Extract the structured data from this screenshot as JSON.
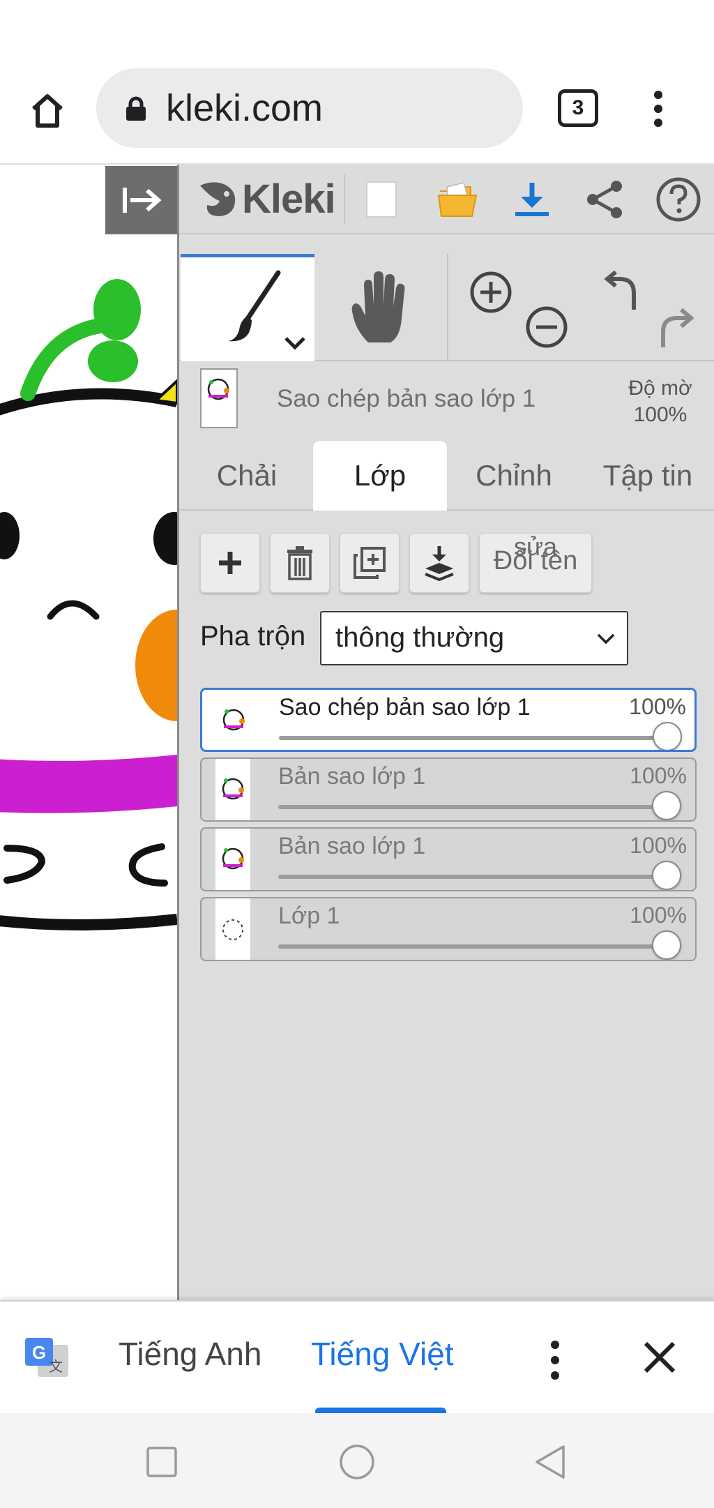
{
  "browser": {
    "url": "kleki.com",
    "tab_count": "3"
  },
  "app": {
    "logo_text": "Kleki"
  },
  "layer_info": {
    "name": "Sao chép bản sao lớp 1",
    "opacity_label": "Độ mờ",
    "opacity_value": "100%"
  },
  "tabs": [
    {
      "label": "Chải",
      "active": false
    },
    {
      "label": "Lớp",
      "active": true
    },
    {
      "label": "Chỉnh",
      "active": false
    },
    {
      "label": "Tập tin",
      "active": false
    }
  ],
  "actions": {
    "rename_top": "sửa",
    "rename_label": "Đổi tên"
  },
  "blend": {
    "label": "Pha trộn",
    "value": "thông thường"
  },
  "layers": [
    {
      "name": "Sao chép bản sao lớp 1",
      "opacity": "100%",
      "selected": true
    },
    {
      "name": "Bản sao lớp 1",
      "opacity": "100%",
      "selected": false
    },
    {
      "name": "Bản sao lớp 1",
      "opacity": "100%",
      "selected": false
    },
    {
      "name": "Lớp 1",
      "opacity": "100%",
      "selected": false
    }
  ],
  "translate": {
    "lang_source": "Tiếng Anh",
    "lang_target": "Tiếng Việt"
  },
  "colors": {
    "accent": "#3a7bd5",
    "translate_blue": "#1a73e8",
    "panel_bg": "#dddddd",
    "save_blue": "#1976d2",
    "folder_yellow": "#f5b731",
    "leaf_green": "#2bbf2b",
    "ribbon_magenta": "#cc1fcf",
    "orange": "#f08a0a"
  },
  "icons": {
    "home": "home-icon",
    "lock": "lock-icon",
    "panel_toggle": "collapse-panel-icon",
    "new": "new-file-icon",
    "open": "open-folder-icon",
    "save": "download-icon",
    "share": "share-icon",
    "help": "help-icon",
    "brush": "brush-icon",
    "hand": "hand-icon",
    "zoom_in": "zoom-in-icon",
    "zoom_out": "zoom-out-icon",
    "undo": "undo-icon",
    "redo": "redo-icon",
    "add": "plus-icon",
    "delete": "trash-icon",
    "duplicate": "duplicate-icon",
    "merge": "merge-down-icon",
    "translate": "google-translate-icon",
    "close": "close-icon"
  }
}
